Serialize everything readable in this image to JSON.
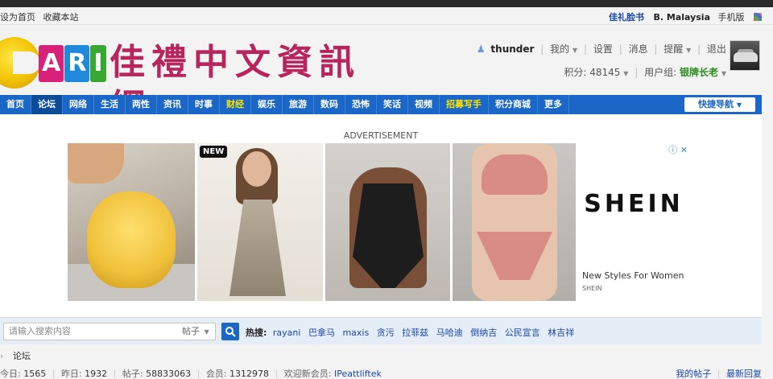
{
  "topbar": {
    "set_home": "设为首页",
    "bookmark": "收藏本站",
    "facebook": "佳礼脸书",
    "country": "B. Malaysia",
    "mobile": "手机版"
  },
  "logo": {
    "letters": [
      "A",
      "R",
      "I"
    ],
    "title_cn": "佳禮中文資訊網"
  },
  "user": {
    "name": "thunder",
    "links": [
      "我的",
      "设置",
      "消息",
      "提醒",
      "退出"
    ],
    "points_label": "积分: 48145",
    "group_label": "用户组:",
    "group_value": "银牌长老"
  },
  "nav": {
    "items": [
      {
        "label": "首页",
        "state": "normal"
      },
      {
        "label": "论坛",
        "state": "active"
      },
      {
        "label": "网络",
        "state": "normal"
      },
      {
        "label": "生活",
        "state": "normal"
      },
      {
        "label": "两性",
        "state": "normal"
      },
      {
        "label": "资讯",
        "state": "normal"
      },
      {
        "label": "时事",
        "state": "normal"
      },
      {
        "label": "财经",
        "state": "highlight"
      },
      {
        "label": "娱乐",
        "state": "normal"
      },
      {
        "label": "旅游",
        "state": "normal"
      },
      {
        "label": "数码",
        "state": "normal"
      },
      {
        "label": "恐怖",
        "state": "normal"
      },
      {
        "label": "笑话",
        "state": "normal"
      },
      {
        "label": "视频",
        "state": "normal"
      },
      {
        "label": "招募写手",
        "state": "highlight"
      },
      {
        "label": "积分商城",
        "state": "normal"
      },
      {
        "label": "更多",
        "state": "normal"
      }
    ],
    "quick_nav": "快捷导航"
  },
  "ad": {
    "label": "ADVERTISEMENT",
    "badge": "NEW",
    "brand": "SHEIN",
    "slogan": "New Styles For Women",
    "sub": "SHEIN"
  },
  "search": {
    "placeholder": "请输入搜索内容",
    "type": "帖子",
    "hot_label": "热搜:",
    "hot_tags": [
      "rayani",
      "巴拿马",
      "maxis",
      "贪污",
      "拉菲兹",
      "马哈迪",
      "倒纳吉",
      "公民宣言",
      "林吉祥"
    ]
  },
  "breadcrumb": {
    "current": "论坛"
  },
  "stats": {
    "today_label": "今日:",
    "today": "1565",
    "yesterday_label": "昨日:",
    "yesterday": "1932",
    "posts_label": "帖子:",
    "posts": "58833063",
    "members_label": "会员:",
    "members": "1312978",
    "newest_label": "欢迎新会员:",
    "newest": "IPeattliftek",
    "my_posts": "我的帖子",
    "latest_replies": "最新回复"
  },
  "colors": {
    "nav_bg": "#1a67c7",
    "nav_active": "#0c4c99",
    "nav_highlight": "#ffe400",
    "logo_title": "#b8255d",
    "link": "#1a47a8",
    "rank": "#2a8c1f"
  }
}
